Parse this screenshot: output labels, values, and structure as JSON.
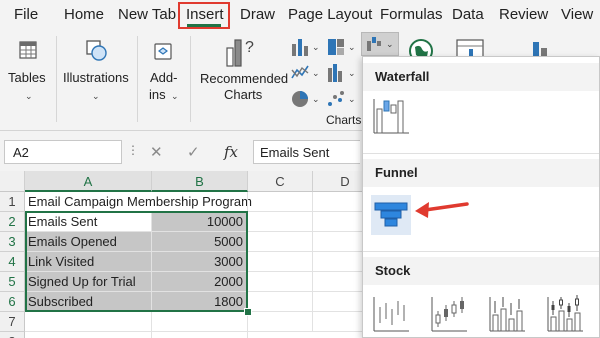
{
  "ribbon_tabs": [
    "File",
    "Home",
    "New Tab",
    "Insert",
    "Draw",
    "Page Layout",
    "Formulas",
    "Data",
    "Review",
    "View"
  ],
  "active_tab": "Insert",
  "ribbon": {
    "tables": "Tables",
    "illustrations": "Illustrations",
    "addins": [
      "Add-",
      "ins"
    ],
    "recommended_charts": [
      "Recommended",
      "Charts"
    ],
    "charts_group": "Charts"
  },
  "formula_bar": {
    "name_box": "A2",
    "cancel": "✕",
    "enter": "✓",
    "fx": "fx",
    "formula": "Emails Sent"
  },
  "sheet": {
    "columns": [
      "A",
      "B",
      "C",
      "D"
    ],
    "rows": [
      "1",
      "2",
      "3",
      "4",
      "5",
      "6",
      "7",
      "8"
    ],
    "title_cell": "Email Campaign Membership Program",
    "data": [
      {
        "label": "Emails Sent",
        "value": "10000"
      },
      {
        "label": "Emails Opened",
        "value": "5000"
      },
      {
        "label": "Link Visited",
        "value": "3000"
      },
      {
        "label": "Signed Up for Trial",
        "value": "2000"
      },
      {
        "label": "Subscribed",
        "value": "1800"
      }
    ]
  },
  "chart_menu": {
    "sections": [
      "Waterfall",
      "Funnel",
      "Stock"
    ]
  },
  "colors": {
    "excel_green": "#217346",
    "highlight_red": "#e03a2f",
    "funnel_blue": "#2e86de"
  }
}
